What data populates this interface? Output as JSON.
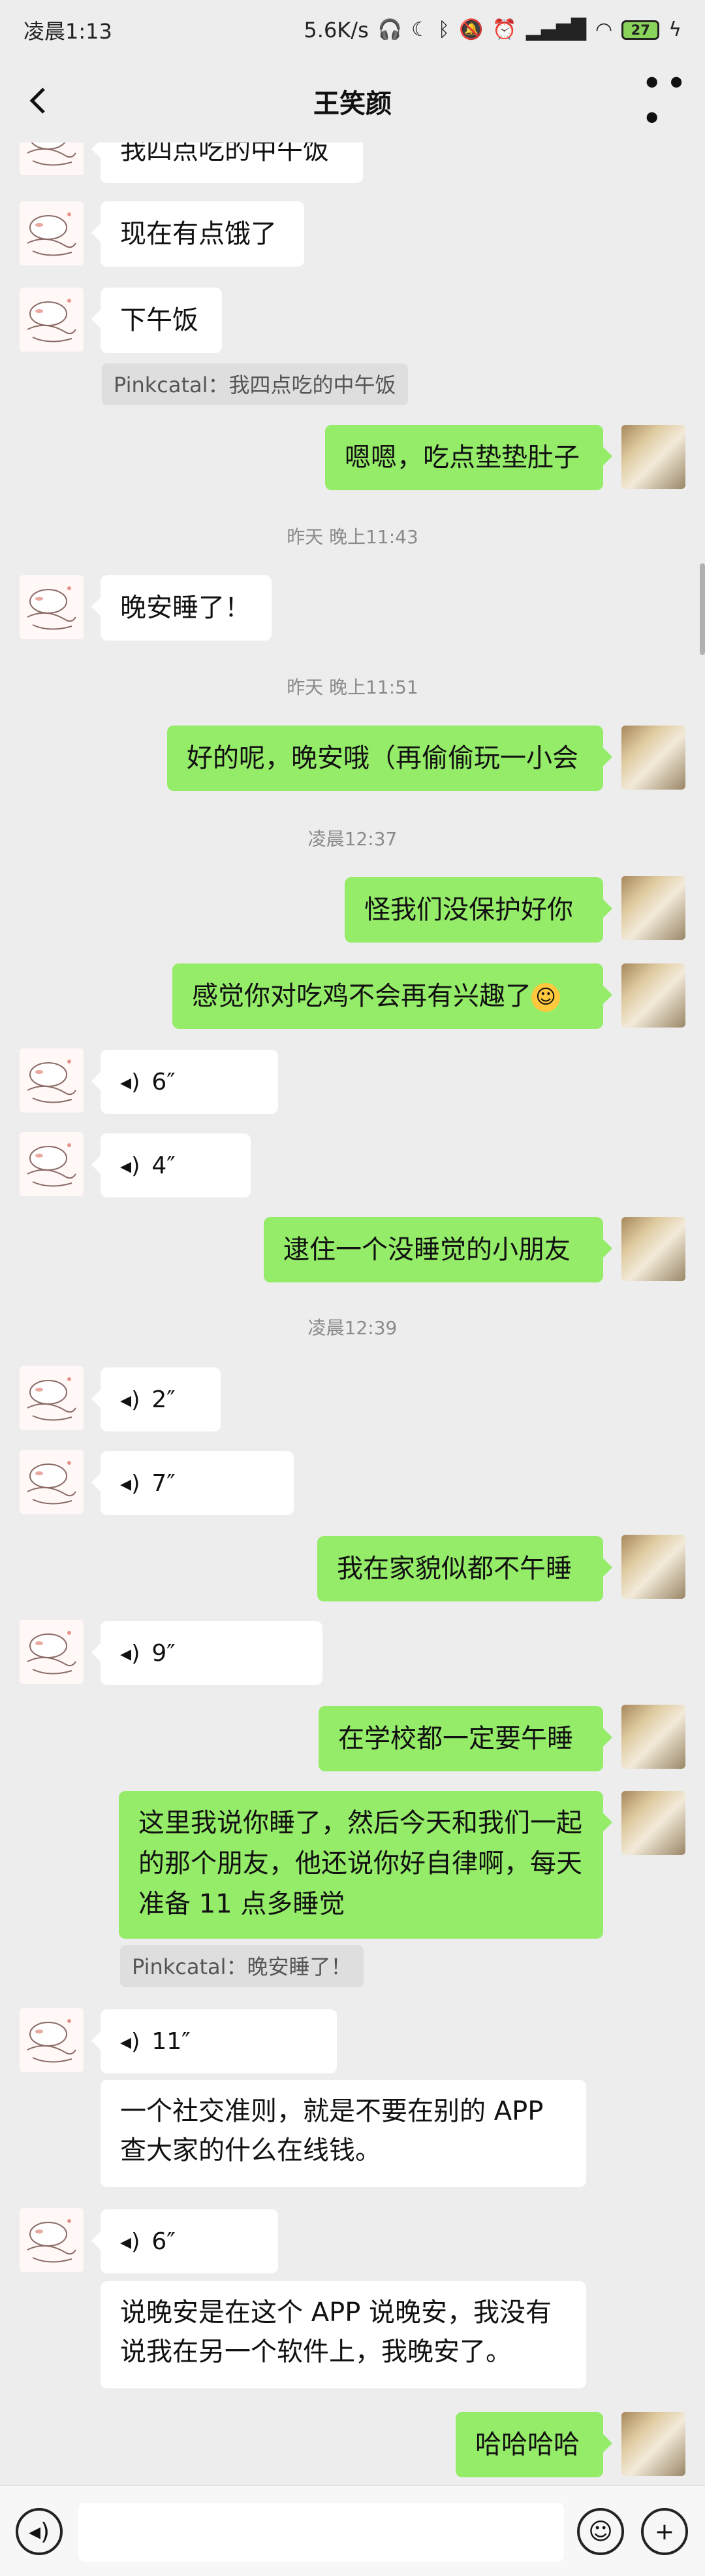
{
  "status_bar": {
    "time": "凌晨1:13",
    "network_speed": "5.6K/s",
    "battery": "27"
  },
  "header": {
    "title": "王笑颜"
  },
  "messages": {
    "m1": "我四点吃的中午饭",
    "m2": "现在有点饿了",
    "m3": "下午饭",
    "q1": "Pinkcatal：我四点吃的中午饭",
    "m4": "嗯嗯，吃点垫垫肚子",
    "t1": "昨天 晚上11:43",
    "m5": "晚安睡了！",
    "t2": "昨天 晚上11:51",
    "m6": "好的呢，晚安哦（再偷偷玩一小会",
    "t3": "凌晨12:37",
    "m7": "怪我们没保护好你",
    "m8": "感觉你对吃鸡不会再有兴趣了",
    "v1": "6″",
    "v2": "4″",
    "m9": "逮住一个没睡觉的小朋友",
    "t4": "凌晨12:39",
    "v3": "2″",
    "v4": "7″",
    "m10": "我在家貌似都不午睡",
    "v5": "9″",
    "m11": "在学校都一定要午睡",
    "m12_l1": "这里我说你睡了，然后今天和我们一起",
    "m12_l2": "的那个朋友，他还说你好自律啊，每天",
    "m12_l3": "准备 11 点多睡觉",
    "q2": "Pinkcatal：晚安睡了！",
    "v6": "11″",
    "m13_l1": "一个社交准则，就是不要在别的 APP",
    "m13_l2": "查大家的什么在线钱。",
    "v7": "6″",
    "m14_l1": "说晚安是在这个 APP 说晚安，我没有",
    "m14_l2": "说我在另一个软件上，我晚安了。",
    "m15": "哈哈哈哈"
  },
  "colors": {
    "background": "#ededed",
    "bubble_self": "#95ec69",
    "bubble_other": "#ffffff"
  },
  "icons": [
    "back-icon",
    "more-icon",
    "voice-icon",
    "emoji-icon",
    "plus-icon",
    "voice-input-icon"
  ]
}
